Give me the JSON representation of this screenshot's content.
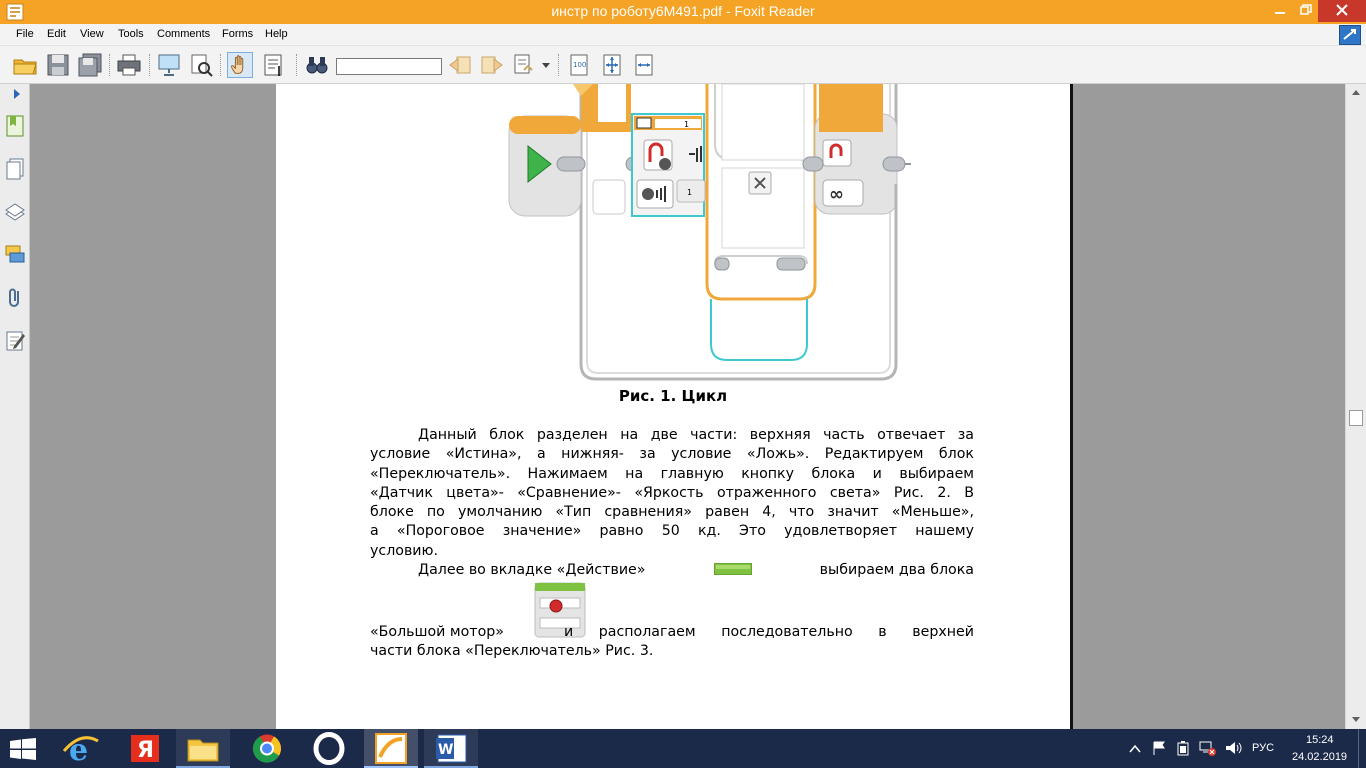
{
  "window": {
    "title": "инстр по роботу6М491.pdf - Foxit Reader"
  },
  "menu": [
    "File",
    "Edit",
    "View",
    "Tools",
    "Comments",
    "Forms",
    "Help"
  ],
  "toolbar": {
    "search_value": ""
  },
  "document": {
    "figure_label_1": "1",
    "figure_label_2": "1",
    "caption": "Рис. 1. Цикл",
    "para1_lines": [
      "Данный блок разделен на две части: верхняя часть отвечает за",
      "условие «Истина», а нижняя- за условие «Ложь». Редактируем блок",
      "«Переключатель». Нажимаем на главную кнопку блока и выбираем",
      "«Датчик цвета»- «Сравнение»- «Яркость отраженного света» Рис. 2. В",
      "блоке по умолчанию «Тип сравнения» равен 4, что значит «Меньше»,",
      "а «Пороговое значение» равно 50 кд. Это удовлетворяет нашему",
      "условию."
    ],
    "para2_a": "Далее во вкладке «Действие»",
    "para2_b": "выбираем два блока",
    "para2_c": "«Большой мотор»",
    "para2_d": "и располагаем последовательно в верхней",
    "para2_e": "части блока «Переключатель» Рис. 3."
  },
  "tray": {
    "lang": "РУС",
    "time": "15:24",
    "date": "24.02.2019"
  }
}
